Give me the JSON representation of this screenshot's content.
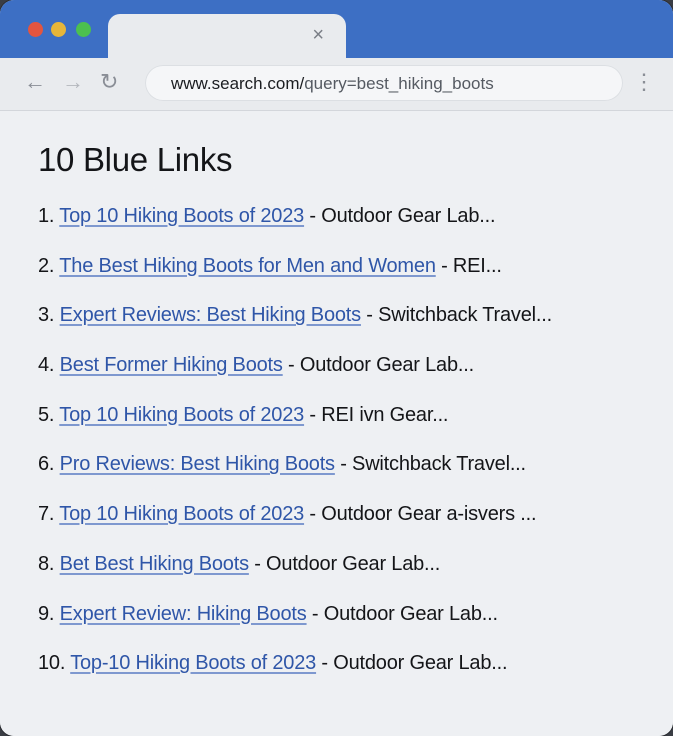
{
  "browser": {
    "tab_close_glyph": "×",
    "address": {
      "host": "www.search.com/",
      "path": "query=best_hiking_boots"
    },
    "nav": {
      "back_glyph": "←",
      "forward_glyph": "→",
      "reload_glyph": "↻",
      "menu_glyph": "⋮"
    },
    "colors": {
      "tabbar": "#3d6fc4",
      "link": "#2f56a8",
      "traffic_red": "#e3553f",
      "traffic_yellow": "#e7b63a",
      "traffic_green": "#4cc04f"
    }
  },
  "page": {
    "heading": "10 Blue Links",
    "results": [
      {
        "num": "1.",
        "title": "Top 10 Hiking Boots of 2023",
        "source": " - Outdoor Gear Lab..."
      },
      {
        "num": "2.",
        "title": "The Best Hiking Boots for Men and Women",
        "source": " - REI..."
      },
      {
        "num": "3.",
        "title": "Expert Reviews: Best Hiking Boots",
        "source": " - Switchback Travel..."
      },
      {
        "num": "4.",
        "title": "Best Former Hiking Boots",
        "source": " - Outdoor Gear Lab..."
      },
      {
        "num": "5.",
        "title": "Top 10 Hiking Boots of 2023",
        "source": " - REI ivn Gear..."
      },
      {
        "num": "6.",
        "title": "Pro Reviews: Best Hiking Boots",
        "source": " - Switchback Travel..."
      },
      {
        "num": "7.",
        "title": "Top 10 Hiking Boots of 2023",
        "source": " - Outdoor Gear a-isvers ..."
      },
      {
        "num": "8.",
        "title": "Bet Best Hiking Boots",
        "source": " - Outdoor Gear Lab..."
      },
      {
        "num": "9.",
        "title": "Expert Review: Hiking Boots",
        "source": " - Outdoor Gear Lab..."
      },
      {
        "num": "10.",
        "title": "Top-10 Hiking Boots of 2023",
        "source": " - Outdoor Gear Lab..."
      }
    ]
  }
}
